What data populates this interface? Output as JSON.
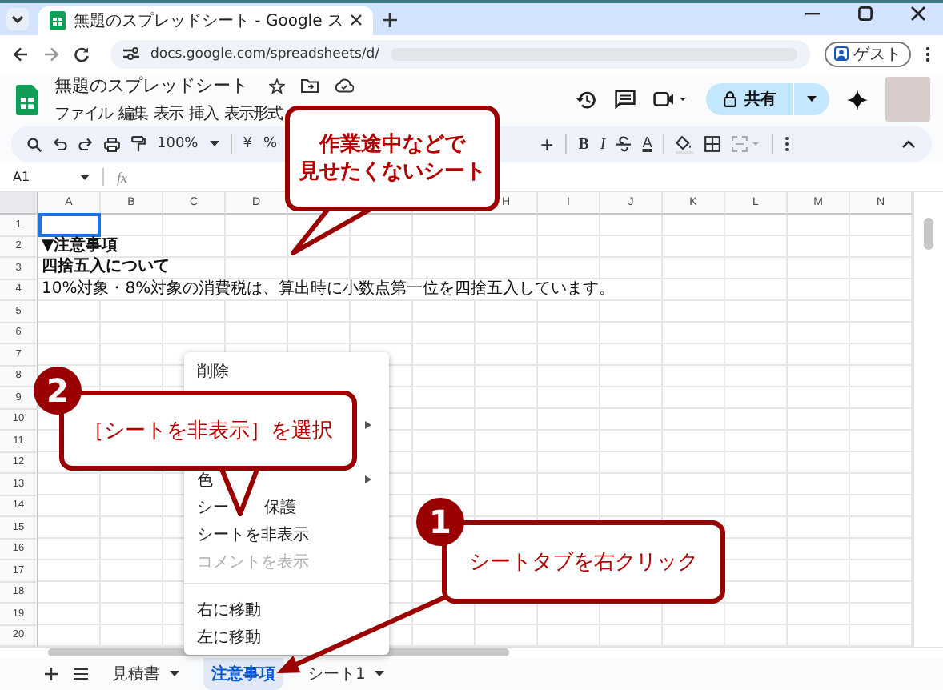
{
  "browser": {
    "tab_title": "無題のスプレッドシート - Google ス",
    "url": "docs.google.com/spreadsheets/d/",
    "profile": "ゲスト"
  },
  "doc": {
    "title": "無題のスプレッドシート",
    "menu": [
      "ファイル",
      "編集",
      "表示",
      "挿入",
      "表示形式"
    ],
    "share": "共有"
  },
  "toolbar": {
    "zoom": "100%",
    "currency": "¥",
    "percent": "%",
    "plus": "+",
    "bold": "B",
    "italic": "I",
    "text_color": "A"
  },
  "formula_bar": {
    "cell_ref": "A1",
    "fx": "fx"
  },
  "grid": {
    "columns_left": [
      "A",
      "B",
      "C",
      "D"
    ],
    "columns_right": [
      "H",
      "I",
      "J",
      "K",
      "L",
      "M",
      "N"
    ],
    "rows": [
      {
        "number": "1",
        "cell_a": {
          "selected": true
        }
      },
      {
        "number": "2",
        "cell_a": {
          "text": "▼注意事項",
          "selected": false
        }
      },
      {
        "number": "3",
        "cell_a": {
          "text": "四捨五入について",
          "selected": false
        }
      },
      {
        "number": "4",
        "cell_a": {
          "text": "10%対象・8%対象の消費税は、算出時に小数点第一位を四捨五入しています。",
          "selected": false
        }
      },
      {
        "number": "5",
        "cell_a": {
          "selected": false
        }
      },
      {
        "number": "6",
        "cell_a": {
          "selected": false
        }
      },
      {
        "number": "7",
        "cell_a": {
          "selected": false
        }
      },
      {
        "number": "8",
        "cell_a": {
          "selected": false
        }
      },
      {
        "number": "9",
        "cell_a": {
          "selected": false
        }
      },
      {
        "number": "10",
        "cell_a": {
          "selected": false
        }
      },
      {
        "number": "11",
        "cell_a": {
          "selected": false
        }
      },
      {
        "number": "12",
        "cell_a": {
          "selected": false
        }
      },
      {
        "number": "13",
        "cell_a": {
          "selected": false
        }
      },
      {
        "number": "14",
        "cell_a": {
          "selected": false
        }
      },
      {
        "number": "15",
        "cell_a": {
          "selected": false
        }
      },
      {
        "number": "16",
        "cell_a": {
          "selected": false
        }
      },
      {
        "number": "17",
        "cell_a": {
          "selected": false
        }
      },
      {
        "number": "18",
        "cell_a": {
          "selected": false
        }
      },
      {
        "number": "19",
        "cell_a": {
          "selected": false
        }
      },
      {
        "number": "20",
        "cell_a": {
          "selected": false
        }
      }
    ]
  },
  "context_menu": {
    "items": [
      {
        "kind": "item",
        "label": "削除",
        "submenu": false,
        "disabled": false
      },
      {
        "kind": "covered",
        "submenu": false
      },
      {
        "kind": "covered",
        "submenu": true
      },
      {
        "kind": "covered",
        "submenu": false
      },
      {
        "kind": "item",
        "label": "色",
        "submenu": true,
        "disabled": false
      },
      {
        "kind": "split",
        "label": "シー",
        "label_2": "保護",
        "disabled": false
      },
      {
        "kind": "item",
        "label": "シートを非表示",
        "submenu": false,
        "disabled": false
      },
      {
        "kind": "item",
        "label": "コメントを表示",
        "submenu": false,
        "disabled": true
      },
      {
        "kind": "divider"
      },
      {
        "kind": "item",
        "label": "右に移動",
        "submenu": false,
        "disabled": false
      },
      {
        "kind": "item",
        "label": "左に移動",
        "submenu": false,
        "disabled": false
      }
    ]
  },
  "sheet_tabs": [
    {
      "label": "見積書",
      "selected": false,
      "dropdown": true
    },
    {
      "label": "注意事項",
      "selected": true,
      "dropdown": false
    },
    {
      "label": "シート1",
      "selected": false,
      "dropdown": true
    }
  ],
  "callouts": [
    {
      "lines": [
        "作業途中などで",
        "見せたくないシート"
      ]
    },
    {
      "number": "2",
      "lines": [
        "［シートを非表示］を選択"
      ]
    },
    {
      "number": "1",
      "lines": [
        "シートタブを右クリック"
      ]
    }
  ]
}
